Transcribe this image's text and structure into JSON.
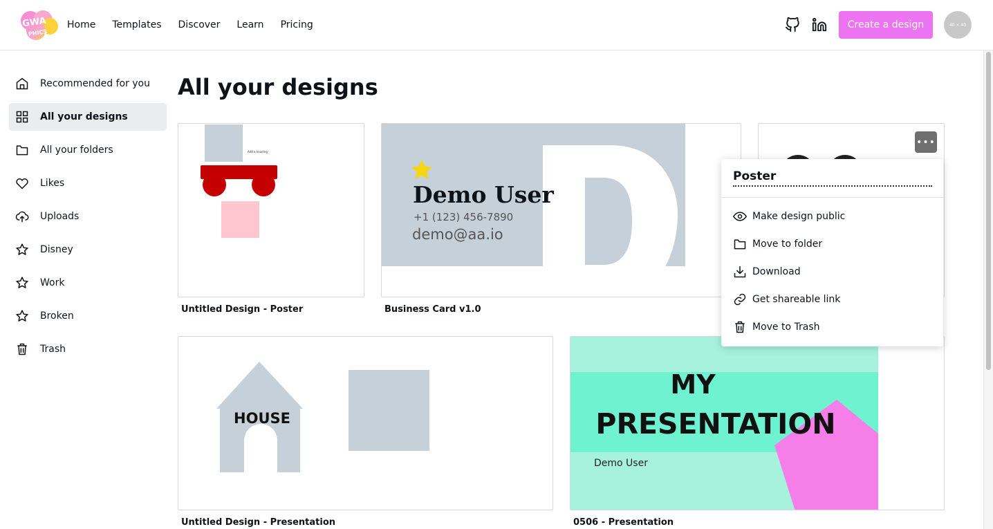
{
  "header": {
    "logo_text_1": "GWA",
    "logo_text_2": "PHICS",
    "nav": [
      "Home",
      "Templates",
      "Discover",
      "Learn",
      "Pricing"
    ],
    "create_label": "Create a design",
    "avatar_text": "40 × 40",
    "icons": [
      "github-icon",
      "linkedin-icon"
    ]
  },
  "sidebar": {
    "items": [
      {
        "label": "Recommended for you",
        "icon": "home-icon"
      },
      {
        "label": "All your designs",
        "icon": "grid-icon",
        "active": true
      },
      {
        "label": "All your folders",
        "icon": "folder-icon"
      },
      {
        "label": "Likes",
        "icon": "heart-icon"
      },
      {
        "label": "Uploads",
        "icon": "upload-icon"
      },
      {
        "label": "Disney",
        "icon": "star-icon"
      },
      {
        "label": "Work",
        "icon": "star-icon"
      },
      {
        "label": "Broken",
        "icon": "star-icon"
      },
      {
        "label": "Trash",
        "icon": "trash-icon"
      }
    ]
  },
  "main": {
    "title": "All your designs",
    "designs": [
      {
        "title": "Untitled Design - Poster",
        "thumb_text": "Add a heading"
      },
      {
        "title": "Business Card v1.0",
        "name": "Demo User",
        "phone": "+1 (123) 456-7890",
        "email": "demo@aa.io"
      },
      {
        "title": ""
      },
      {
        "title": "Untitled Design - Presentation",
        "thumb_text": "HOUSE"
      },
      {
        "title": "0506 - Presentation",
        "line1": "MY",
        "line2": "PRESENTATION",
        "author": "Demo User"
      }
    ]
  },
  "menu": {
    "title": "Poster",
    "more_label": "•••",
    "items": [
      {
        "label": "Make design public",
        "icon": "eye-icon"
      },
      {
        "label": "Move to folder",
        "icon": "folder-icon"
      },
      {
        "label": "Download",
        "icon": "download-icon"
      },
      {
        "label": "Get shareable link",
        "icon": "link-icon"
      },
      {
        "label": "Move to Trash",
        "icon": "trash-icon"
      }
    ]
  },
  "colors": {
    "accent": "#ec73f2",
    "thumb_gray": "#c6d0d8",
    "red": "#c40000",
    "pink": "#ffc6cf",
    "teal": "#6ff2cf",
    "mint": "#a6f2dd",
    "magenta": "#f57ee8"
  }
}
